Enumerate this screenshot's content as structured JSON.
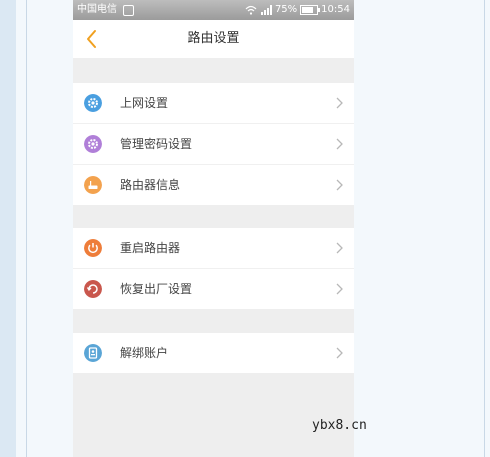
{
  "status_bar": {
    "carrier": "中国电信",
    "battery": "75%",
    "time": "10:54"
  },
  "nav": {
    "title": "路由设置"
  },
  "groups": [
    {
      "items": [
        {
          "label": "上网设置",
          "icon": "gear-icon",
          "color": "#4a9fe0"
        },
        {
          "label": "管理密码设置",
          "icon": "gear-icon",
          "color": "#b07fd8"
        },
        {
          "label": "路由器信息",
          "icon": "router-icon",
          "color": "#f3a24e"
        }
      ]
    },
    {
      "items": [
        {
          "label": "重启路由器",
          "icon": "power-icon",
          "color": "#ee7d3a"
        },
        {
          "label": "恢复出厂设置",
          "icon": "reset-icon",
          "color": "#c9574d"
        }
      ]
    },
    {
      "items": [
        {
          "label": "解绑账户",
          "icon": "account-card-icon",
          "color": "#5aa5d6"
        }
      ]
    }
  ],
  "watermark": "ybx8.cn",
  "colors": {
    "accent": "#f0a020",
    "background": "#eeeeee"
  }
}
